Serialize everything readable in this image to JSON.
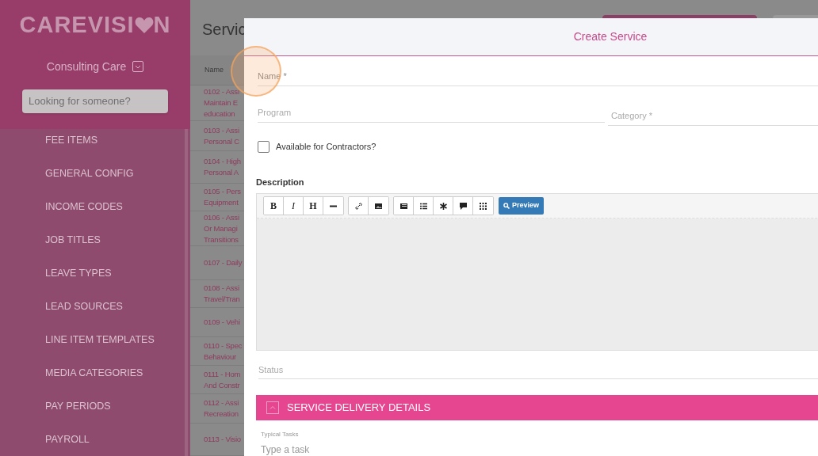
{
  "sidebar": {
    "logo": {
      "before": "CAREVISI",
      "after": "N"
    },
    "organisation": "Consulting Care",
    "search": {
      "placeholder": "Looking for someone?"
    },
    "items": [
      "FEE ITEMS",
      "GENERAL CONFIG",
      "INCOME CODES",
      "JOB TITLES",
      "LEAVE TYPES",
      "LEAD SOURCES",
      "LINE ITEM TEMPLATES",
      "MEDIA CATEGORIES",
      "PAY PERIODS",
      "PAYROLL"
    ]
  },
  "page": {
    "title": "Servic",
    "table": {
      "columns": [
        "Name"
      ],
      "rows": [
        {
          "lines": [
            "0102 - Assi",
            "Maintain E",
            "education"
          ]
        },
        {
          "lines": [
            "0103 - Assi",
            "Personal C"
          ]
        },
        {
          "lines": [
            "0104 - High",
            "Personal A"
          ]
        },
        {
          "lines": [
            "0105 - Pers",
            "Equipment"
          ]
        },
        {
          "lines": [
            "0106 - Assi",
            "Or Managi",
            "Transitions"
          ]
        },
        {
          "lines": [
            "0107 - Daily"
          ]
        },
        {
          "lines": [
            "0108 - Assi",
            "Travel/Tran"
          ]
        },
        {
          "lines": [
            "0109 - Vehi"
          ]
        },
        {
          "lines": [
            "0110 - Spec",
            "Behaviour"
          ]
        },
        {
          "lines": [
            "0111 - Hom",
            "And Constr"
          ]
        },
        {
          "lines": [
            "0112 - Assi",
            "Recreation"
          ]
        },
        {
          "lines": [
            "0113 - Visio"
          ]
        }
      ]
    }
  },
  "modal": {
    "title": "Create Service",
    "name_field": {
      "placeholder": "Name *"
    },
    "program_field": {
      "placeholder": "Program"
    },
    "category_field": {
      "placeholder": "Category *"
    },
    "contractors": {
      "label": "Available for Contractors?",
      "checked": false
    },
    "description": {
      "label": "Description",
      "text_buttons": [
        "B",
        "I",
        "H"
      ],
      "preview": "Preview"
    },
    "status_field": {
      "placeholder": "Status"
    },
    "section": {
      "title": "SERVICE DELIVERY DETAILS",
      "expanded": true
    },
    "typical_tasks": {
      "label": "Typical Tasks",
      "placeholder": "Type a task"
    }
  }
}
